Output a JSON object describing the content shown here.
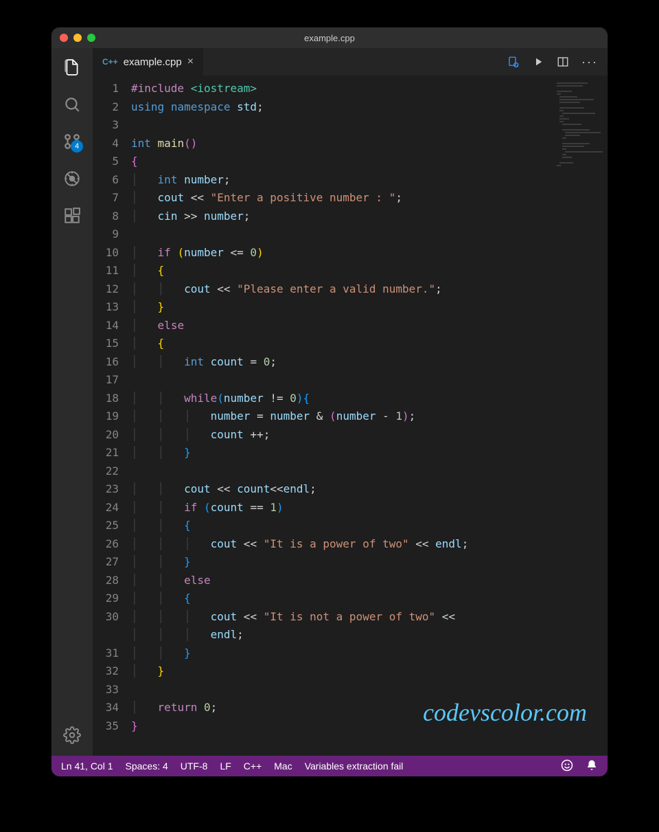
{
  "window": {
    "title": "example.cpp"
  },
  "activity": {
    "explorer": "explorer-icon",
    "search": "search-icon",
    "scm": "source-control-icon",
    "scm_badge": "4",
    "debug": "debug-icon",
    "extensions": "extensions-icon",
    "settings": "settings-icon"
  },
  "tab": {
    "lang_tag": "C++",
    "label": "example.cpp",
    "close": "×"
  },
  "editor_actions": {
    "changes": "go-to-changes-icon",
    "run": "run-icon",
    "split": "split-editor-icon",
    "more": "···"
  },
  "code": {
    "lines": [
      {
        "n": 1,
        "html": "<span class='tok-pp'>#include</span> <span class='tok-inc'>&lt;iostream&gt;</span>"
      },
      {
        "n": 2,
        "html": "<span class='tok-kw'>using</span> <span class='tok-kw'>namespace</span> <span class='tok-var'>std</span>;"
      },
      {
        "n": 3,
        "html": ""
      },
      {
        "n": 4,
        "html": "<span class='tok-type'>int</span> <span class='tok-fn'>main</span><span class='tok-brace'>()</span>"
      },
      {
        "n": 5,
        "html": "<span class='tok-brace'>{</span>"
      },
      {
        "n": 6,
        "html": "<span class='indent-guide'>│</span>   <span class='tok-type'>int</span> <span class='tok-var'>number</span>;"
      },
      {
        "n": 7,
        "html": "<span class='indent-guide'>│</span>   <span class='tok-var'>cout</span> &lt;&lt; <span class='tok-str'>\"Enter a positive number : \"</span>;"
      },
      {
        "n": 8,
        "html": "<span class='indent-guide'>│</span>   <span class='tok-var'>cin</span> &gt;&gt; <span class='tok-var'>number</span>;"
      },
      {
        "n": 9,
        "html": ""
      },
      {
        "n": 10,
        "html": "<span class='indent-guide'>│</span>   <span class='tok-pp'>if</span> <span class='tok-brace2'>(</span><span class='tok-var'>number</span> &lt;= <span class='tok-num'>0</span><span class='tok-brace2'>)</span>"
      },
      {
        "n": 11,
        "html": "<span class='indent-guide'>│</span>   <span class='tok-brace2'>{</span>"
      },
      {
        "n": 12,
        "html": "<span class='indent-guide'>│</span>   <span class='indent-guide'>│</span>   <span class='tok-var'>cout</span> &lt;&lt; <span class='tok-str'>\"Please enter a valid number.\"</span>;"
      },
      {
        "n": 13,
        "html": "<span class='indent-guide'>│</span>   <span class='tok-brace2'>}</span>"
      },
      {
        "n": 14,
        "html": "<span class='indent-guide'>│</span>   <span class='tok-pp'>else</span>"
      },
      {
        "n": 15,
        "html": "<span class='indent-guide'>│</span>   <span class='tok-brace2'>{</span>"
      },
      {
        "n": 16,
        "html": "<span class='indent-guide'>│</span>   <span class='indent-guide'>│</span>   <span class='tok-type'>int</span> <span class='tok-var'>count</span> = <span class='tok-num'>0</span>;"
      },
      {
        "n": 17,
        "html": ""
      },
      {
        "n": 18,
        "html": "<span class='indent-guide'>│</span>   <span class='indent-guide'>│</span>   <span class='tok-pp'>while</span><span class='tok-brace3'>(</span><span class='tok-var'>number</span> != <span class='tok-num'>0</span><span class='tok-brace3'>){</span>"
      },
      {
        "n": 19,
        "html": "<span class='indent-guide'>│</span>   <span class='indent-guide'>│</span>   <span class='indent-guide'>│</span>   <span class='tok-var'>number</span> = <span class='tok-var'>number</span> &amp; <span class='tok-brace'>(</span><span class='tok-var'>number</span> - <span class='tok-num'>1</span><span class='tok-brace'>)</span>;"
      },
      {
        "n": 20,
        "html": "<span class='indent-guide'>│</span>   <span class='indent-guide'>│</span>   <span class='indent-guide'>│</span>   <span class='tok-var'>count</span> ++;"
      },
      {
        "n": 21,
        "html": "<span class='indent-guide'>│</span>   <span class='indent-guide'>│</span>   <span class='tok-brace3'>}</span>"
      },
      {
        "n": 22,
        "html": ""
      },
      {
        "n": 23,
        "html": "<span class='indent-guide'>│</span>   <span class='indent-guide'>│</span>   <span class='tok-var'>cout</span> &lt;&lt; <span class='tok-var'>count</span>&lt;&lt;<span class='tok-var'>endl</span>;"
      },
      {
        "n": 24,
        "html": "<span class='indent-guide'>│</span>   <span class='indent-guide'>│</span>   <span class='tok-pp'>if</span> <span class='tok-brace3'>(</span><span class='tok-var'>count</span> == <span class='tok-num'>1</span><span class='tok-brace3'>)</span>"
      },
      {
        "n": 25,
        "html": "<span class='indent-guide'>│</span>   <span class='indent-guide'>│</span>   <span class='tok-brace3'>{</span>"
      },
      {
        "n": 26,
        "html": "<span class='indent-guide'>│</span>   <span class='indent-guide'>│</span>   <span class='indent-guide'>│</span>   <span class='tok-var'>cout</span> &lt;&lt; <span class='tok-str'>\"It is a power of two\"</span> &lt;&lt; <span class='tok-var'>endl</span>;"
      },
      {
        "n": 27,
        "html": "<span class='indent-guide'>│</span>   <span class='indent-guide'>│</span>   <span class='tok-brace3'>}</span>"
      },
      {
        "n": 28,
        "html": "<span class='indent-guide'>│</span>   <span class='indent-guide'>│</span>   <span class='tok-pp'>else</span>"
      },
      {
        "n": 29,
        "html": "<span class='indent-guide'>│</span>   <span class='indent-guide'>│</span>   <span class='tok-brace3'>{</span>"
      },
      {
        "n": 30,
        "html": "<span class='indent-guide'>│</span>   <span class='indent-guide'>│</span>   <span class='indent-guide'>│</span>   <span class='tok-var'>cout</span> &lt;&lt; <span class='tok-str'>\"It is not a power of two\"</span> &lt;&lt; \n<span class='indent-guide'>│</span>   <span class='indent-guide'>│</span>   <span class='indent-guide'>│</span>   <span class='tok-var'>endl</span>;"
      },
      {
        "n": 31,
        "html": "<span class='indent-guide'>│</span>   <span class='indent-guide'>│</span>   <span class='tok-brace3'>}</span>"
      },
      {
        "n": 32,
        "html": "<span class='indent-guide'>│</span>   <span class='tok-brace2'>}</span>"
      },
      {
        "n": 33,
        "html": ""
      },
      {
        "n": 34,
        "html": "<span class='indent-guide'>│</span>   <span class='tok-pp'>return</span> <span class='tok-num'>0</span>;"
      },
      {
        "n": 35,
        "html": "<span class='tok-brace'>}</span>"
      }
    ]
  },
  "statusbar": {
    "cursor": "Ln 41, Col 1",
    "spaces": "Spaces: 4",
    "encoding": "UTF-8",
    "eol": "LF",
    "language": "C++",
    "os": "Mac",
    "msg": "Variables extraction fail"
  },
  "watermark": "codevscolor.com"
}
